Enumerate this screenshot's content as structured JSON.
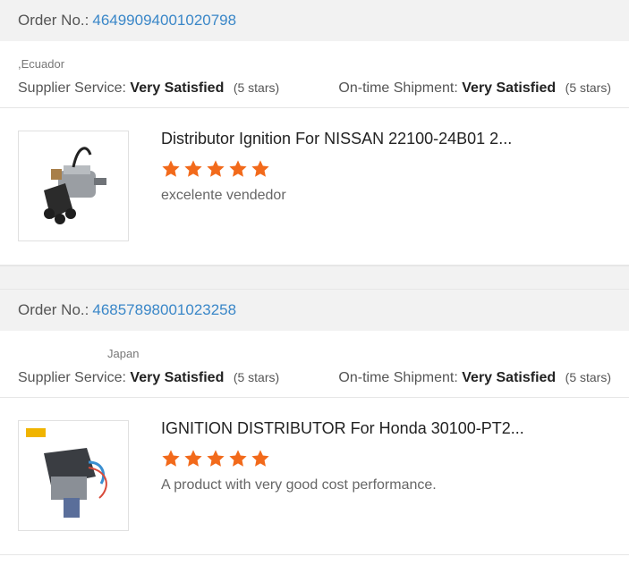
{
  "orders": [
    {
      "order_label": "Order No.:",
      "order_number": "46499094001020798",
      "country": ",Ecuador",
      "supplier_label": "Supplier Service:",
      "supplier_value": "Very Satisfied",
      "supplier_stars": "(5 stars)",
      "shipment_label": "On-time Shipment:",
      "shipment_value": "Very Satisfied",
      "shipment_stars": "(5 stars)",
      "product_title": "Distributor Ignition For NISSAN 22100-24B01 2...",
      "rating": 5,
      "comment": "excelente vendedor",
      "thumb_icon": "ignition-distributor-image"
    },
    {
      "order_label": "Order No.:",
      "order_number": "46857898001023258",
      "country": "Japan",
      "supplier_label": "Supplier Service:",
      "supplier_value": "Very Satisfied",
      "supplier_stars": "(5 stars)",
      "shipment_label": "On-time Shipment:",
      "shipment_value": "Very Satisfied",
      "shipment_stars": "(5 stars)",
      "product_title": "IGNITION DISTRIBUTOR For Honda 30100-PT2...",
      "rating": 5,
      "comment": "A product with very good cost performance.",
      "thumb_icon": "ignition-distributor-image"
    }
  ],
  "colors": {
    "star": "#f26a1b",
    "order_number": "#3a87c8"
  }
}
